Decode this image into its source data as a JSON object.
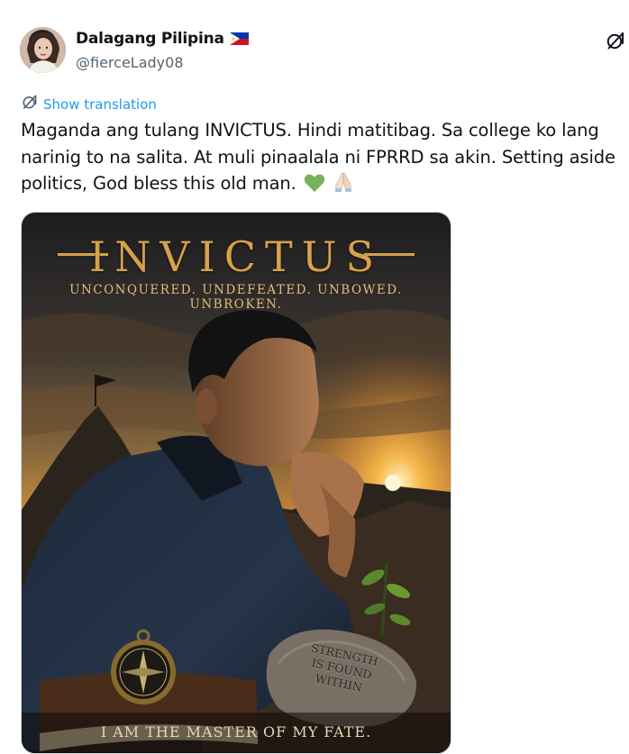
{
  "author": {
    "display_name": "Dalagang Pilipina",
    "handle": "@fierceLady08",
    "flag_icon": "philippines-flag"
  },
  "translate": {
    "label": "Show translation"
  },
  "post": {
    "text": "Maganda ang tulang INVICTUS. Hindi matitibag. Sa college ko lang narinig to na salita. At muli pinaalala ni FPRRD sa akin. Setting aside politics, God bless this old man.",
    "emojis": [
      "green-heart",
      "folded-hands"
    ]
  },
  "media": {
    "title": "INVICTUS",
    "tagline": "UNCONQUERED. UNDEFEATED. UNBOWED. UNBROKEN.",
    "stone_text": [
      "STRENGTH",
      "IS FOUND",
      "WITHIN"
    ],
    "bottom_quote": "I AM THE MASTER OF MY FATE."
  },
  "colors": {
    "link": "#1d9bf0",
    "text_primary": "#0f1419",
    "text_secondary": "#536471",
    "poster_gold": "#d7a24b"
  }
}
